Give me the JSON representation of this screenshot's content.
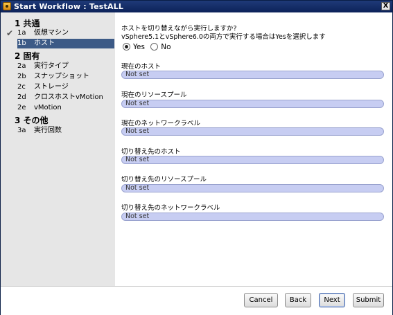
{
  "window": {
    "title": "Start Workflow : TestALL",
    "close_label": "X"
  },
  "sidebar": {
    "sections": [
      {
        "label": "1  共通",
        "items": [
          {
            "num": "1a",
            "label": "仮想マシン",
            "checked": true
          },
          {
            "num": "1b",
            "label": "ホスト",
            "selected": true
          }
        ]
      },
      {
        "label": "2  固有",
        "items": [
          {
            "num": "2a",
            "label": "実行タイプ"
          },
          {
            "num": "2b",
            "label": "スナップショット"
          },
          {
            "num": "2c",
            "label": "ストレージ"
          },
          {
            "num": "2d",
            "label": "クロスホストvMotion"
          },
          {
            "num": "2e",
            "label": "vMotion"
          }
        ]
      },
      {
        "label": "3  その他",
        "items": [
          {
            "num": "3a",
            "label": "実行回数"
          }
        ]
      }
    ]
  },
  "main": {
    "question_line1": "ホストを切り替えながら実行しますか?",
    "question_line2": "vSphere5.1とvSphere6.0の両方で実行する場合はYesを選択します",
    "radio": {
      "yes_label": "Yes",
      "no_label": "No",
      "selected": "Yes"
    },
    "fields": [
      {
        "label": "現在のホスト",
        "value": "Not set"
      },
      {
        "label": "現在のリソースプール",
        "value": "Not set"
      },
      {
        "label": "現在のネットワークラベル",
        "value": "Not set"
      },
      {
        "label": "切り替え先のホスト",
        "value": "Not set"
      },
      {
        "label": "切り替え先のリソースプール",
        "value": "Not set"
      },
      {
        "label": "切り替え先のネットワークラベル",
        "value": "Not set"
      }
    ]
  },
  "footer": {
    "cancel_label": "Cancel",
    "back_label": "Back",
    "next_label": "Next",
    "submit_label": "Submit"
  }
}
